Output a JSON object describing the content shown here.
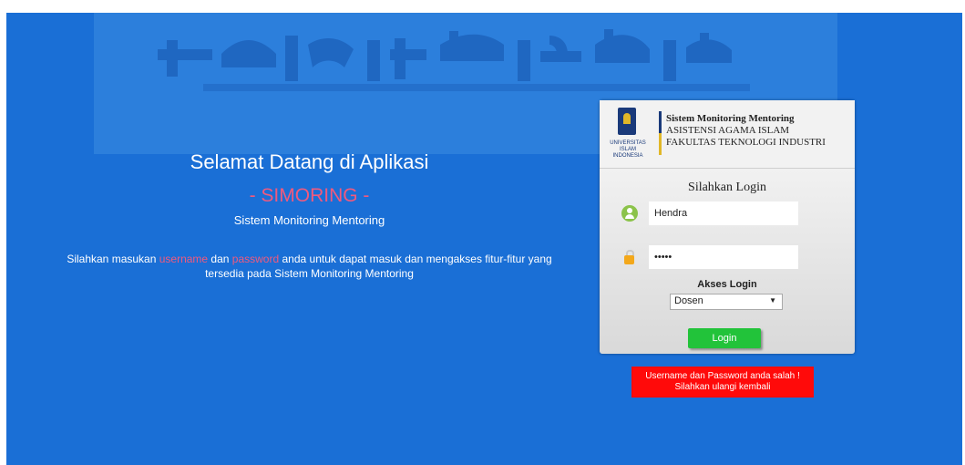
{
  "welcome": {
    "title": "Selamat Datang di Aplikasi",
    "app_name": "- SIMORING -",
    "subtitle": "Sistem Monitoring Mentoring",
    "desc_part1": "Silahkan masukan ",
    "desc_username": "username",
    "desc_part2": " dan ",
    "desc_password": "password",
    "desc_part3": " anda untuk dapat masuk dan mengakses fitur-fitur yang tersedia pada Sistem Monitoring Mentoring"
  },
  "login_card": {
    "logo_text": [
      "UNIVERSITAS",
      "ISLAM",
      "INDONESIA"
    ],
    "header_line1": "Sistem Monitoring Mentoring",
    "header_line2": "ASISTENSI AGAMA ISLAM",
    "header_line3": "FAKULTAS TEKNOLOGI INDUSTRI",
    "title": "Silahkan Login",
    "username_value": "Hendra",
    "password_value": "•••••",
    "akses_label": "Akses Login",
    "akses_selected": "Dosen",
    "akses_arrow": "▼",
    "login_button": "Login"
  },
  "error": {
    "line1": "Username dan Password anda salah !",
    "line2": "Silahkan ulangi kembali"
  },
  "colors": {
    "background": "#1a6fd6",
    "accent_pink": "#f05a7e",
    "login_button": "#22c33a",
    "error": "#ff0a0a"
  },
  "icons": {
    "user": "user-icon",
    "password": "lock-icon",
    "banner": "arabic-calligraphy-banner"
  }
}
